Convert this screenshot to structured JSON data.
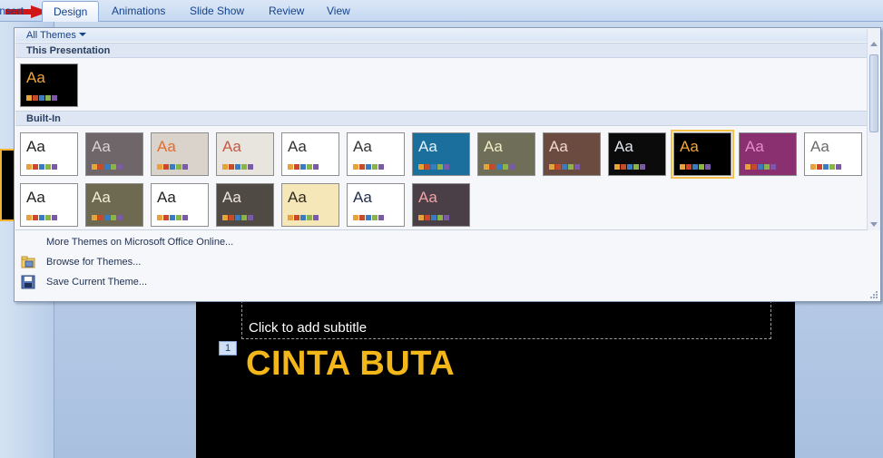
{
  "ribbon": {
    "tabs": [
      {
        "label": "Insert",
        "active": false
      },
      {
        "label": "Design",
        "active": true
      },
      {
        "label": "Animations",
        "active": false
      },
      {
        "label": "Slide Show",
        "active": false
      },
      {
        "label": "Review",
        "active": false
      },
      {
        "label": "View",
        "active": false
      }
    ]
  },
  "gallery": {
    "filter_label": "All Themes",
    "section_this": "This Presentation",
    "section_builtin": "Built-In",
    "menu": {
      "more": "More Themes on Microsoft Office Online...",
      "browse": "Browse for Themes...",
      "save": "Save Current Theme..."
    }
  },
  "themes": {
    "current": {
      "label": "Aa",
      "bg": "#000000",
      "fg": "#f2a634"
    },
    "builtin": [
      {
        "label": "Aa",
        "bg": "#ffffff",
        "fg": "#222222"
      },
      {
        "label": "Aa",
        "bg": "#6f6669",
        "fg": "#d8d0d4"
      },
      {
        "label": "Aa",
        "bg": "#d9d3cc",
        "fg": "#e36d2c"
      },
      {
        "label": "Aa",
        "bg": "#e8e4de",
        "fg": "#c55a44"
      },
      {
        "label": "Aa",
        "bg": "#ffffff",
        "fg": "#333333"
      },
      {
        "label": "Aa",
        "bg": "#ffffff",
        "fg": "#333333"
      },
      {
        "label": "Aa",
        "bg": "#1b6f9c",
        "fg": "#e6f4fb"
      },
      {
        "label": "Aa",
        "bg": "#6f6e58",
        "fg": "#f2edc6"
      },
      {
        "label": "Aa",
        "bg": "#6b4b3f",
        "fg": "#f0d9cf"
      },
      {
        "label": "Aa",
        "bg": "#0b0b0b",
        "fg": "#dfe6ef"
      },
      {
        "label": "Aa",
        "bg": "#000000",
        "fg": "#f2a634",
        "selected": true
      },
      {
        "label": "Aa",
        "bg": "#8a2f6f",
        "fg": "#e58bc6"
      },
      {
        "label": "Aa",
        "bg": "#ffffff",
        "fg": "#6b6b6b"
      },
      {
        "label": "Aa",
        "bg": "#ffffff",
        "fg": "#222222"
      },
      {
        "label": "Aa",
        "bg": "#6e6a52",
        "fg": "#f2ecd2"
      },
      {
        "label": "Aa",
        "bg": "#ffffff",
        "fg": "#222222"
      },
      {
        "label": "Aa",
        "bg": "#4f4a44",
        "fg": "#ece7de"
      },
      {
        "label": "Aa",
        "bg": "#f6e7b8",
        "fg": "#2f2a20"
      },
      {
        "label": "Aa",
        "bg": "#ffffff",
        "fg": "#1f2c4a"
      },
      {
        "label": "Aa",
        "bg": "#4a3e47",
        "fg": "#f2a3a3"
      }
    ]
  },
  "slide": {
    "number": "1",
    "subtitle_placeholder": "Click to add subtitle",
    "title": "CINTA BUTA"
  }
}
